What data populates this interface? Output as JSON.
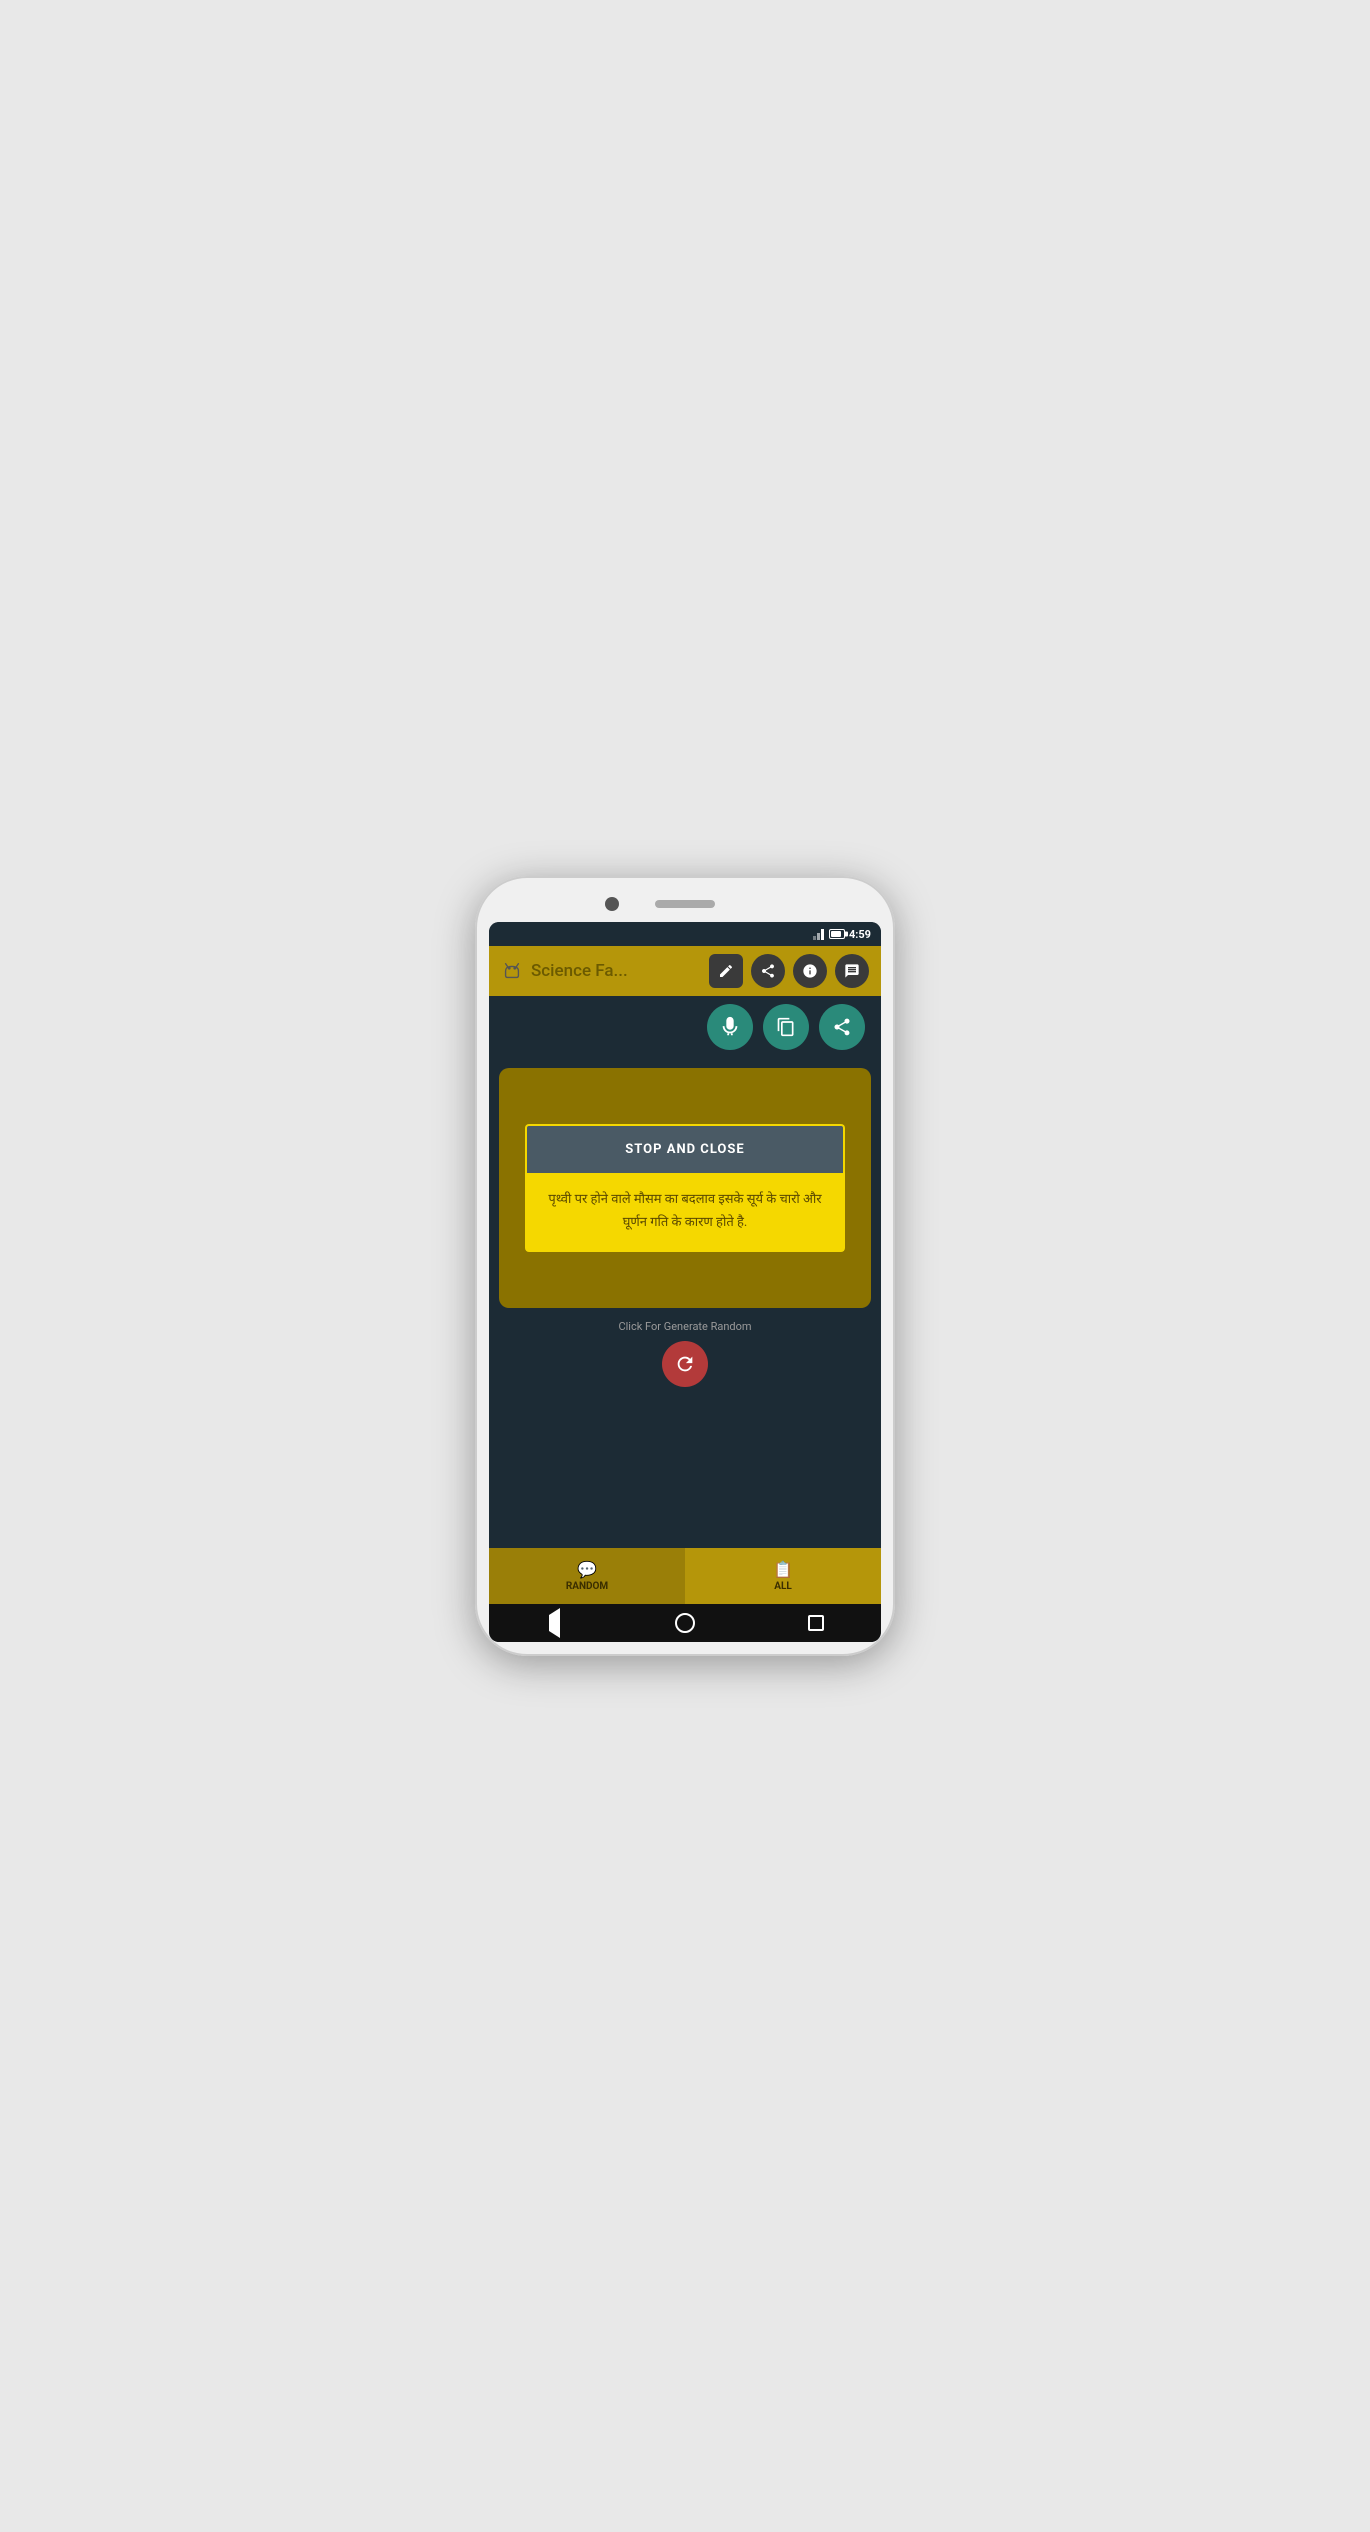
{
  "phone": {
    "status_bar": {
      "time": "4:59"
    },
    "app_bar": {
      "title": "Science Fa...",
      "icon_edit": "✏",
      "icon_share": "⋮",
      "icon_info": "ℹ",
      "icon_chat": "💬"
    },
    "action_buttons": {
      "btn1_label": "speaker",
      "btn2_label": "copy",
      "btn3_label": "share"
    },
    "dialog": {
      "stop_close_label": "STOP AND CLOSE",
      "hindi_text": "पृथ्वी पर होने वाले मौसम का बदलाव इसके सूर्य के चारो और घूर्णन गति के कारण होते है."
    },
    "main": {
      "generate_label": "Click For Generate Random",
      "refresh_label": "↻"
    },
    "tab_bar": {
      "tab1_label": "RANDOM",
      "tab2_label": "ALL"
    },
    "nav_bar": {
      "back_label": "◁",
      "home_label": "○",
      "recents_label": "□"
    }
  }
}
